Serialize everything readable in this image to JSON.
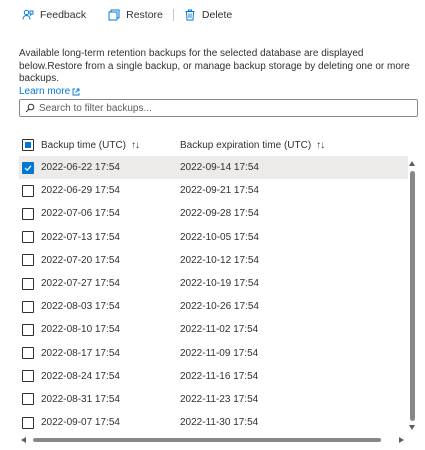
{
  "toolbar": {
    "feedback_label": "Feedback",
    "restore_label": "Restore",
    "delete_label": "Delete"
  },
  "description": "Available long-term retention backups for the selected database are displayed below.Restore from a single backup, or manage backup storage by deleting one or more backups.",
  "learn_more": "Learn more",
  "search": {
    "placeholder": "Search to filter backups..."
  },
  "table": {
    "col1": "Backup time (UTC)",
    "col2": "Backup expiration time (UTC)",
    "sort_icon": "↑↓",
    "rows": [
      {
        "backup": "2022-06-22 17:54",
        "expires": "2022-09-14 17:54",
        "checked": true
      },
      {
        "backup": "2022-06-29 17:54",
        "expires": "2022-09-21 17:54",
        "checked": false
      },
      {
        "backup": "2022-07-06 17:54",
        "expires": "2022-09-28 17:54",
        "checked": false
      },
      {
        "backup": "2022-07-13 17:54",
        "expires": "2022-10-05 17:54",
        "checked": false
      },
      {
        "backup": "2022-07-20 17:54",
        "expires": "2022-10-12 17:54",
        "checked": false
      },
      {
        "backup": "2022-07-27 17:54",
        "expires": "2022-10-19 17:54",
        "checked": false
      },
      {
        "backup": "2022-08-03 17:54",
        "expires": "2022-10-26 17:54",
        "checked": false
      },
      {
        "backup": "2022-08-10 17:54",
        "expires": "2022-11-02 17:54",
        "checked": false
      },
      {
        "backup": "2022-08-17 17:54",
        "expires": "2022-11-09 17:54",
        "checked": false
      },
      {
        "backup": "2022-08-24 17:54",
        "expires": "2022-11-16 17:54",
        "checked": false
      },
      {
        "backup": "2022-08-31 17:54",
        "expires": "2022-11-23 17:54",
        "checked": false
      },
      {
        "backup": "2022-09-07 17:54",
        "expires": "2022-11-30 17:54",
        "checked": false
      }
    ]
  },
  "colors": {
    "accent": "#0078d4",
    "selected_row": "#edebe9"
  }
}
